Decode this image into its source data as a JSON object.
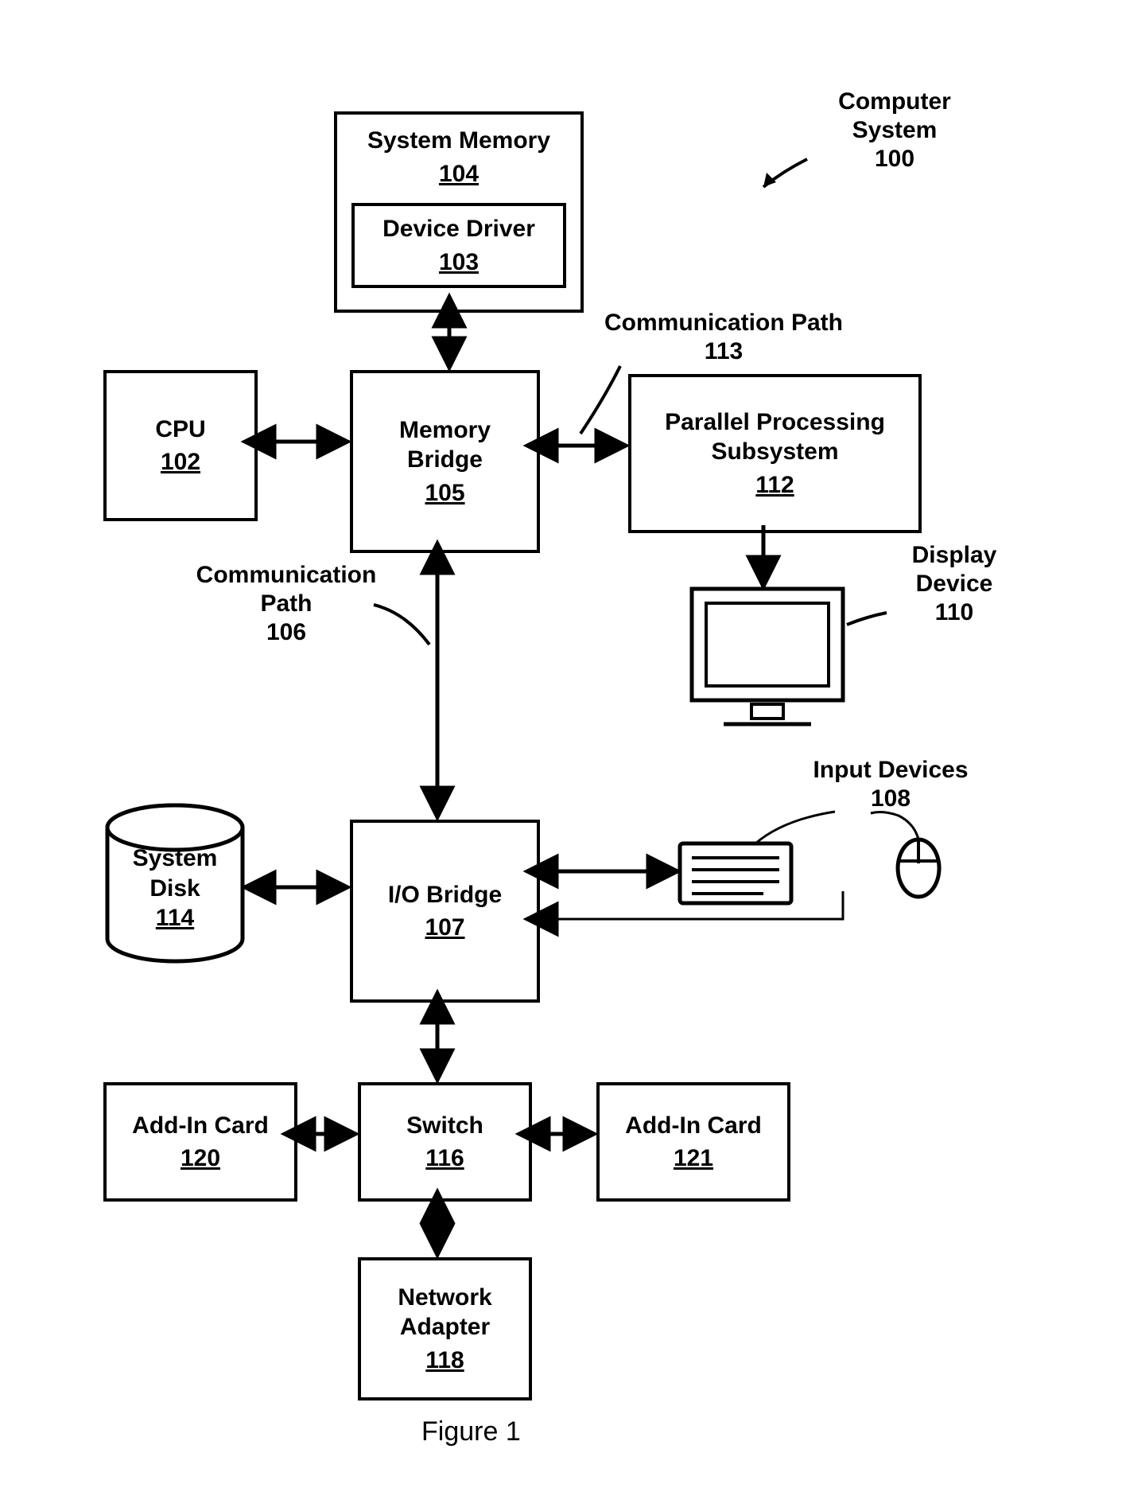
{
  "title_label": {
    "line1": "Computer",
    "line2": "System",
    "num": "100"
  },
  "figure_caption": "Figure 1",
  "blocks": {
    "system_memory": {
      "title": "System Memory",
      "num": "104"
    },
    "device_driver": {
      "title": "Device Driver",
      "num": "103"
    },
    "cpu": {
      "title": "CPU",
      "num": "102"
    },
    "memory_bridge": {
      "title_line1": "Memory",
      "title_line2": "Bridge",
      "num": "105"
    },
    "pps": {
      "title_line1": "Parallel Processing",
      "title_line2": "Subsystem",
      "num": "112"
    },
    "io_bridge": {
      "title": "I/O Bridge",
      "num": "107"
    },
    "system_disk": {
      "title_line1": "System",
      "title_line2": "Disk",
      "num": "114"
    },
    "switch": {
      "title": "Switch",
      "num": "116"
    },
    "addin_left": {
      "title": "Add-In Card",
      "num": "120"
    },
    "addin_right": {
      "title": "Add-In Card",
      "num": "121"
    },
    "network_adapter": {
      "title_line1": "Network",
      "title_line2": "Adapter",
      "num": "118"
    }
  },
  "labels": {
    "comm_path_113": {
      "line1": "Communication Path",
      "num": "113"
    },
    "comm_path_106": {
      "line1": "Communication",
      "line2": "Path",
      "num": "106"
    },
    "display_device": {
      "line1": "Display",
      "line2": "Device",
      "num": "110"
    },
    "input_devices": {
      "line1": "Input Devices",
      "num": "108"
    }
  }
}
